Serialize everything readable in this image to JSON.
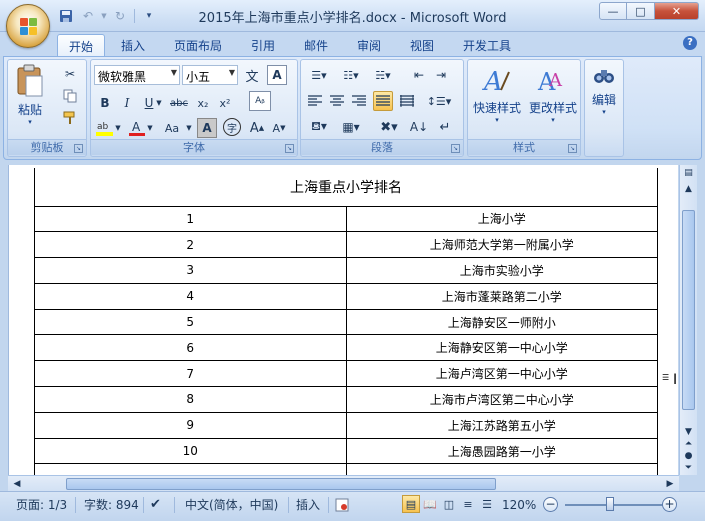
{
  "window": {
    "title": "2015年上海市重点小学排名.docx - Microsoft Word",
    "controls": {
      "minimize": "—",
      "maximize": "□",
      "close": "✕"
    }
  },
  "ribbon_tabs": [
    "开始",
    "插入",
    "页面布局",
    "引用",
    "邮件",
    "审阅",
    "视图",
    "开发工具"
  ],
  "active_tab": "开始",
  "ribbon": {
    "clipboard": {
      "label": "剪贴板",
      "paste_label": "粘贴"
    },
    "font": {
      "label": "字体",
      "font_name": "微软雅黑",
      "font_size": "小五",
      "wen_char": "文",
      "a_char": "A"
    },
    "paragraph": {
      "label": "段落"
    },
    "styles": {
      "label": "样式",
      "quick_styles_label": "快速样式",
      "change_styles_label": "更改样式"
    },
    "editing": {
      "label": "编辑",
      "edit_label": "编辑"
    }
  },
  "document": {
    "table_title": "上海重点小学排名",
    "rows": [
      {
        "rank": "1",
        "school": "上海小学"
      },
      {
        "rank": "2",
        "school": "上海师范大学第一附属小学"
      },
      {
        "rank": "3",
        "school": "上海市实验小学"
      },
      {
        "rank": "4",
        "school": "上海市蓬莱路第二小学"
      },
      {
        "rank": "5",
        "school": "上海静安区一师附小"
      },
      {
        "rank": "6",
        "school": "上海静安区第一中心小学"
      },
      {
        "rank": "7",
        "school": "上海卢湾区第一中心小学"
      },
      {
        "rank": "8",
        "school": "上海市卢湾区第二中心小学"
      },
      {
        "rank": "9",
        "school": "上海江苏路第五小学"
      },
      {
        "rank": "10",
        "school": "上海愚园路第一小学"
      }
    ]
  },
  "statusbar": {
    "page": "页面: 1/3",
    "words": "字数: 894",
    "language": "中文(简体，中国)",
    "insert_mode": "插入",
    "zoom": "120%"
  },
  "colors": {
    "accent": "#15428b",
    "ribbon_bg": "#c2d6ee",
    "selected": "#f7c24f"
  }
}
